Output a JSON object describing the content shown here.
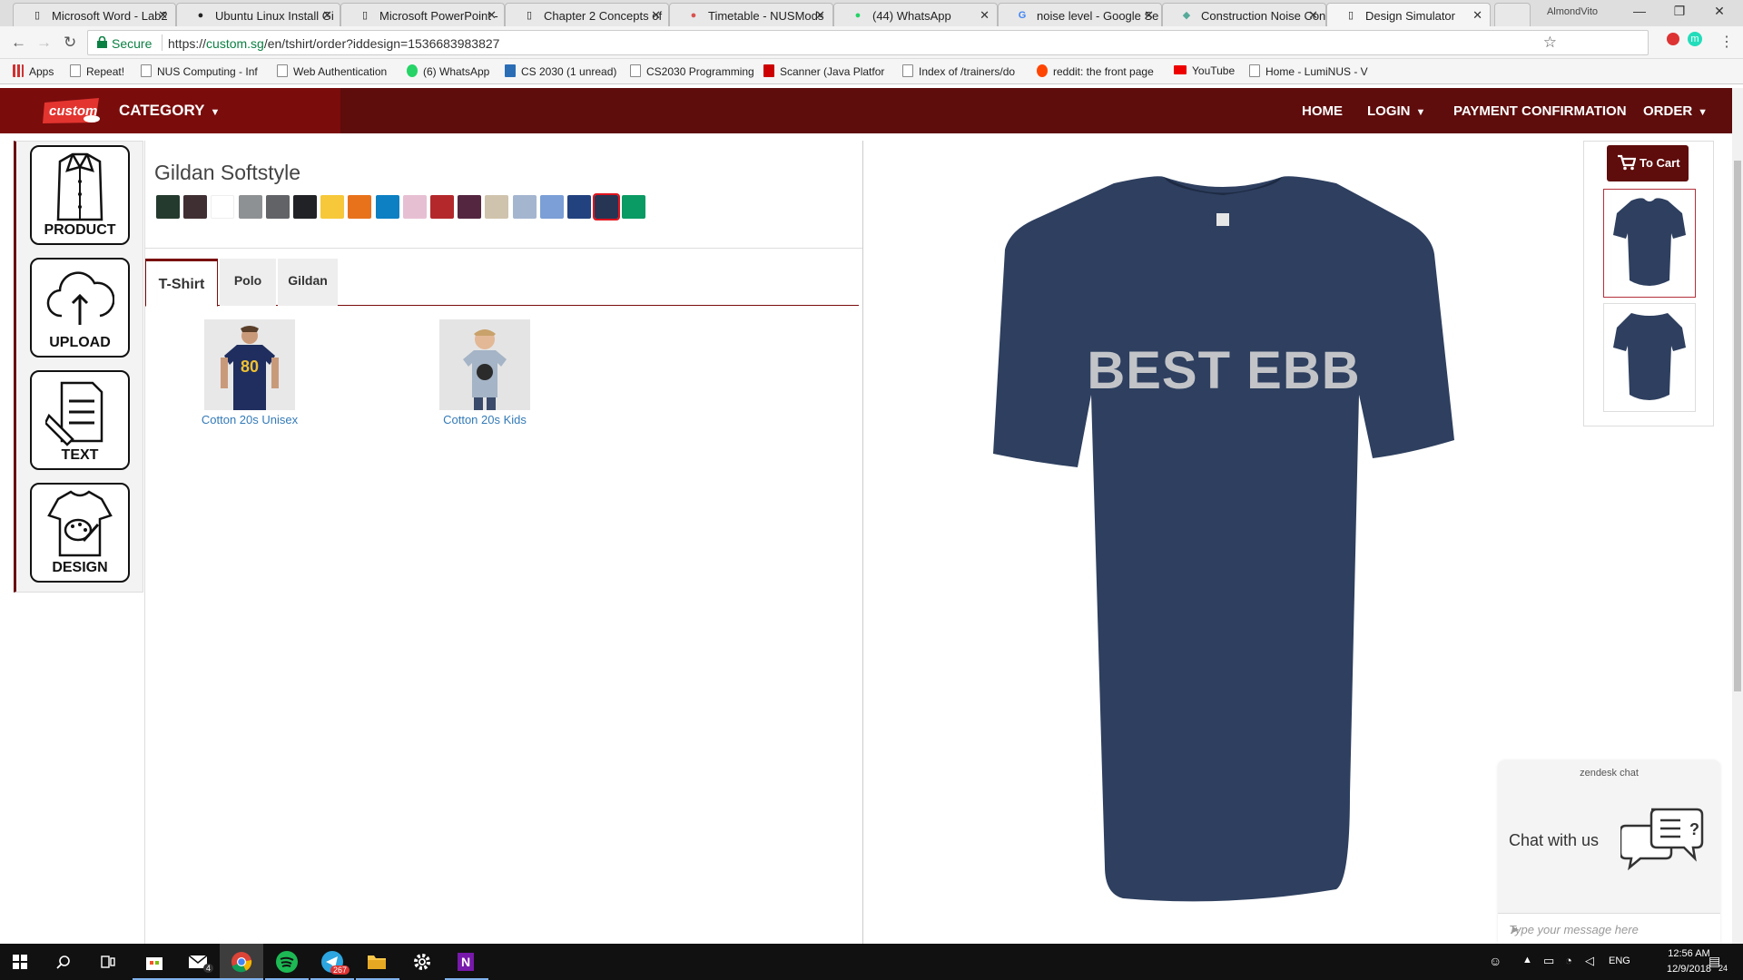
{
  "browser": {
    "tabs": [
      {
        "title": "Microsoft Word - Lab2",
        "fav": "W"
      },
      {
        "title": "Ubuntu Linux Install Gi",
        "fav": "K"
      },
      {
        "title": "Microsoft PowerPoint -",
        "fav": "P"
      },
      {
        "title": "Chapter 2 Concepts of",
        "fav": "C"
      },
      {
        "title": "Timetable - NUSMods",
        "fav": "M"
      },
      {
        "title": "(44) WhatsApp",
        "fav": "W"
      },
      {
        "title": "noise level - Google Se",
        "fav": "G"
      },
      {
        "title": "Construction Noise Con",
        "fav": "C"
      },
      {
        "title": "Design Simulator",
        "fav": "D"
      }
    ],
    "user": "AlmondVito",
    "window_controls": {
      "minimize": "—",
      "restore": "❐",
      "close": "✕"
    },
    "tab_close": "✕",
    "secure_label": "Secure",
    "url_scheme": "https://",
    "url_host": "custom.sg",
    "url_path": "/en/tshirt/order?iddesign=1536683983827",
    "nav": {
      "back": "←",
      "forward": "→",
      "reload": "↻",
      "star": "☆",
      "menu": "⋮"
    },
    "ext_badge": "m",
    "bookmarks": [
      "Apps",
      "Repeat!",
      "NUS Computing - Inf",
      "Web Authentication",
      "(6) WhatsApp",
      "CS 2030 (1 unread)",
      "CS2030 Programming",
      "Scanner (Java Platfor",
      "Index of /trainers/do",
      "reddit: the front page",
      "YouTube",
      "Home - LumiNUS - V"
    ]
  },
  "site": {
    "logo_text": "custom",
    "category_label": "CATEGORY",
    "menu": [
      "HOME",
      "LOGIN",
      "PAYMENT CONFIRMATION",
      "ORDER"
    ],
    "accent": "#5e0c0c"
  },
  "tools": [
    "PRODUCT",
    "UPLOAD",
    "TEXT",
    "DESIGN"
  ],
  "product": {
    "title": "Gildan Softstyle",
    "colors": [
      "#243a2e",
      "#3f2f33",
      "#ffffff",
      "#8e9193",
      "#616366",
      "#212226",
      "#f6c83a",
      "#e8721c",
      "#0c80c2",
      "#e7bfd3",
      "#b4282c",
      "#55263f",
      "#cfc3ad",
      "#a4b5cf",
      "#7b9fd6",
      "#22427f",
      "#263553",
      "#0a9a64"
    ],
    "selected_color_index": 16,
    "tabs": [
      "T-Shirt",
      "Polo",
      "Gildan"
    ],
    "items": [
      {
        "name": "Cotton 20s Unisex"
      },
      {
        "name": "Cotton 20s Kids"
      }
    ]
  },
  "design": {
    "shirt_color": "#2e3f5f",
    "text": "BEST EBB"
  },
  "cart": {
    "label": "To Cart"
  },
  "chat": {
    "title": "zendesk chat",
    "prompt": "Chat with us",
    "placeholder": "Type your message here",
    "send": "➤"
  },
  "taskbar": {
    "lang": "ENG",
    "time": "12:56 AM",
    "date": "12/9/2018",
    "mail_badge": "4",
    "telegram_badge": "267",
    "notif_badge": "24"
  }
}
